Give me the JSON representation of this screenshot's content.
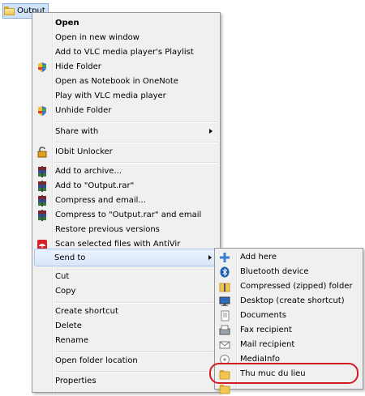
{
  "desktop": {
    "folder_label": "Output"
  },
  "context_menu": {
    "open": "Open",
    "open_new_window": "Open in new window",
    "add_vlc_playlist": "Add to VLC media player's Playlist",
    "hide_folder": "Hide Folder",
    "open_onenote": "Open as Notebook in OneNote",
    "play_vlc": "Play with VLC media player",
    "unhide_folder": "Unhide Folder",
    "share_with": "Share with",
    "iobit_unlocker": "IObit Unlocker",
    "add_archive": "Add to archive...",
    "add_output_rar": "Add to \"Output.rar\"",
    "compress_email": "Compress and email...",
    "compress_output_email": "Compress to \"Output.rar\" and email",
    "restore_versions": "Restore previous versions",
    "scan_antivir": "Scan selected files with AntiVir",
    "send_to": "Send to",
    "cut": "Cut",
    "copy": "Copy",
    "create_shortcut": "Create shortcut",
    "delete": "Delete",
    "rename": "Rename",
    "open_folder_location": "Open folder location",
    "properties": "Properties"
  },
  "send_to_menu": {
    "add_here": "Add here",
    "bluetooth": "Bluetooth device",
    "compressed_folder": "Compressed (zipped) folder",
    "desktop_shortcut": "Desktop (create shortcut)",
    "documents": "Documents",
    "fax_recipient": "Fax recipient",
    "mail_recipient": "Mail recipient",
    "mediainfo": "MediaInfo",
    "thu_muc": "Thu muc du lieu"
  },
  "colors": {
    "menu_bg": "#f0f0f0",
    "highlight": "#d9e7fa",
    "annotation": "#d01d24"
  }
}
